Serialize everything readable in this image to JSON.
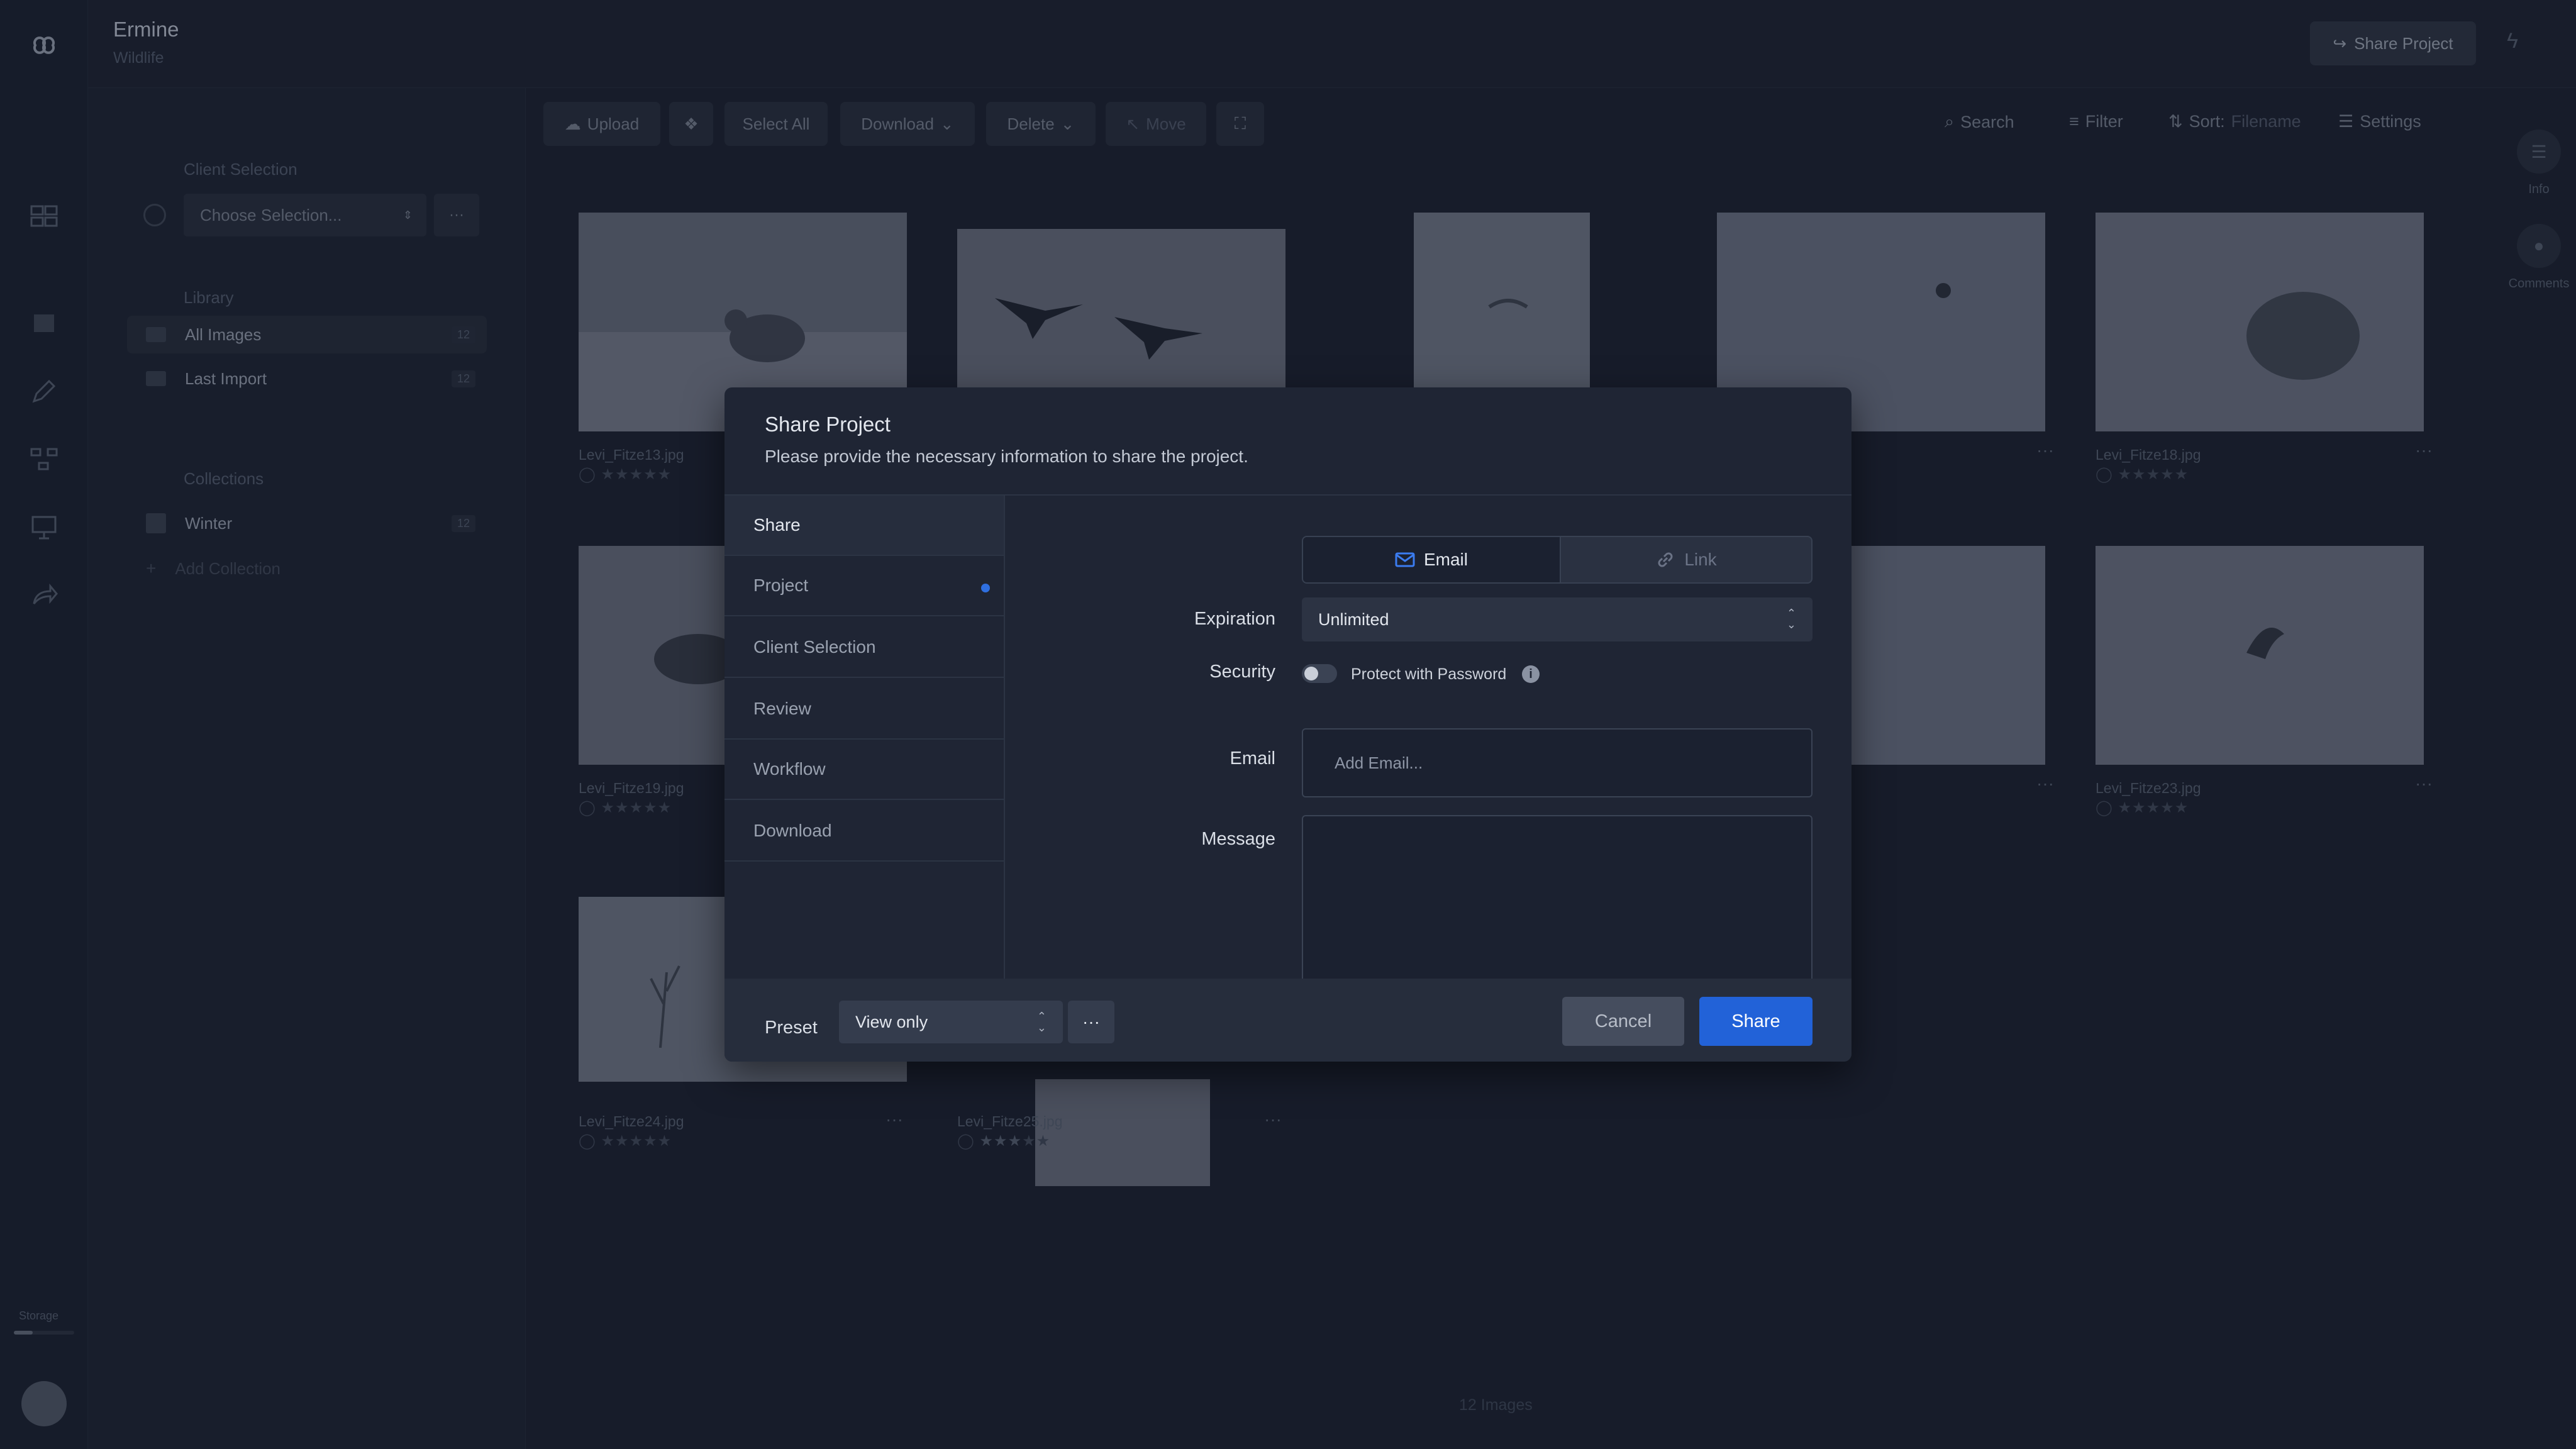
{
  "header": {
    "project_title": "Ermine",
    "project_subtitle": "Wildlife",
    "share_button": "Share Project"
  },
  "sidebar": {
    "client_selection_heading": "Client Selection",
    "choose_selection_placeholder": "Choose Selection...",
    "more_label": "···",
    "library_heading": "Library",
    "library_items": [
      {
        "label": "All Images",
        "count": "12"
      },
      {
        "label": "Last Import",
        "count": "12"
      }
    ],
    "collections_heading": "Collections",
    "collection_items": [
      {
        "label": "Winter",
        "count": "12"
      }
    ],
    "add_collection": "Add Collection",
    "storage_label": "Storage"
  },
  "toolbar": {
    "upload": "Upload",
    "select_all": "Select All",
    "download": "Download",
    "delete": "Delete",
    "move": "Move",
    "search": "Search",
    "filter": "Filter",
    "sort_prefix": "Sort:",
    "sort_value": "Filename",
    "settings": "Settings"
  },
  "right_rail": {
    "info": "Info",
    "comments": "Comments"
  },
  "images": [
    {
      "filename": "Levi_Fitze13.jpg"
    },
    {
      "filename": "Levi_Fitze18.jpg"
    },
    {
      "filename": "Levi_Fitze19.jpg"
    },
    {
      "filename": "Levi_Fitze23.jpg"
    },
    {
      "filename": "Levi_Fitze24.jpg"
    },
    {
      "filename": "Levi_Fitze25.jpg"
    }
  ],
  "stars_full": "★★★★★",
  "stars_three": "★★★",
  "stars_dim": "★★",
  "more_dots": "···",
  "footer": {
    "image_count": "12 Images"
  },
  "modal": {
    "title": "Share Project",
    "subtitle": "Please provide the necessary information to share the project.",
    "nav": [
      {
        "label": "Share"
      },
      {
        "label": "Project"
      },
      {
        "label": "Client Selection"
      },
      {
        "label": "Review"
      },
      {
        "label": "Workflow"
      },
      {
        "label": "Download"
      }
    ],
    "tab_email": "Email",
    "tab_link": "Link",
    "expiration_label": "Expiration",
    "expiration_value": "Unlimited",
    "security_label": "Security",
    "security_toggle_label": "Protect with Password",
    "password_protected": false,
    "email_label": "Email",
    "email_placeholder": "Add Email...",
    "message_label": "Message",
    "preset_label": "Preset",
    "preset_value": "View only",
    "preset_more": "···",
    "cancel": "Cancel",
    "share": "Share"
  },
  "colors": {
    "accent": "#2262d8",
    "background": "#1b2130",
    "modal": "#1f2534"
  }
}
